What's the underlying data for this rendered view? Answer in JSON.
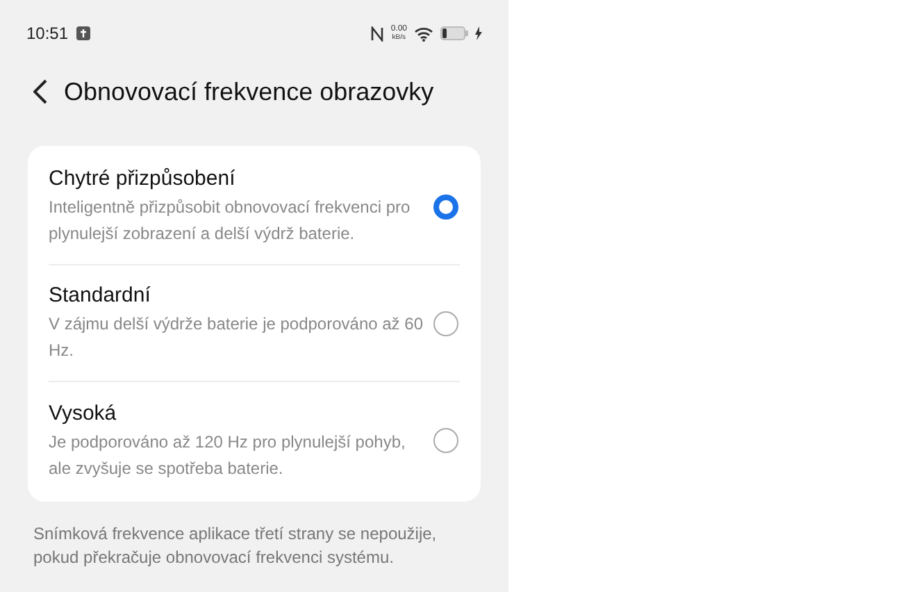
{
  "status_bar": {
    "time": "10:51",
    "speed_value": "0.00",
    "speed_unit": "kB/s"
  },
  "header": {
    "title": "Obnovovací frekvence obrazovky"
  },
  "options": [
    {
      "title": "Chytré přizpůsobení",
      "description": "Inteligentně přizpůsobit obnovovací frekvenci pro plynulejší zobrazení a delší výdrž baterie.",
      "selected": true
    },
    {
      "title": "Standardní",
      "description": "V zájmu delší výdrže baterie je podporováno až 60 Hz.",
      "selected": false
    },
    {
      "title": "Vysoká",
      "description": "Je podporováno až 120 Hz pro plynulejší pohyb, ale zvyšuje se spotřeba baterie.",
      "selected": false
    }
  ],
  "footer_note": "Snímková frekvence aplikace třetí strany se nepoužije, pokud překračuje obnovovací frekvenci systému."
}
